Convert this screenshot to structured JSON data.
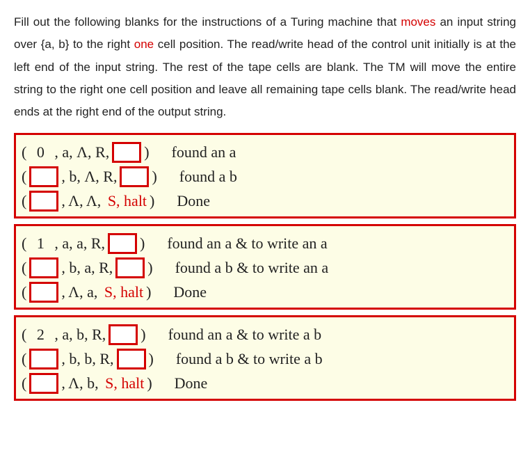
{
  "prompt": {
    "p1a": "Fill out the following blanks for the instructions of a Turing machine that ",
    "p1_moves": "moves",
    "p1b": " an input string over {a, b} to the right ",
    "p1_one": "one",
    "p1c": " cell position. The read/write head of the control unit initially is at the left end of the input string. The rest of the tape cells are blank. The TM will move the entire string to the right one cell position and leave all remaining tape cells blank. The read/write head ends at the right end of the output string."
  },
  "groups": [
    {
      "rows": [
        {
          "state_is_blank": false,
          "state": "0",
          "mid": ", a, Λ, R,",
          "end_blank": true,
          "after_blank": ")",
          "comment": "found an a"
        },
        {
          "state_is_blank": true,
          "state": "",
          "mid": ", b, Λ, R,",
          "end_blank": true,
          "after_blank": ")",
          "comment": "found a b"
        },
        {
          "state_is_blank": true,
          "state": "",
          "mid": ", Λ, Λ, ",
          "halt": "S, halt",
          "after_halt": ")",
          "comment": "Done"
        }
      ]
    },
    {
      "rows": [
        {
          "state_is_blank": false,
          "state": "1",
          "mid": ", a, a, R,",
          "end_blank": true,
          "after_blank": ")",
          "comment": "found an a & to write an a"
        },
        {
          "state_is_blank": true,
          "state": "",
          "mid": ", b, a, R,",
          "end_blank": true,
          "after_blank": ")",
          "comment": "found a b & to write an a"
        },
        {
          "state_is_blank": true,
          "state": "",
          "mid": ", Λ, a, ",
          "halt": "S, halt",
          "after_halt": ")",
          "comment": "Done"
        }
      ]
    },
    {
      "rows": [
        {
          "state_is_blank": false,
          "state": "2",
          "mid": ", a, b, R,",
          "end_blank": true,
          "after_blank": ")",
          "comment": "found an a & to write a b"
        },
        {
          "state_is_blank": true,
          "state": "",
          "mid": ", b, b, R,",
          "end_blank": true,
          "after_blank": ")",
          "comment": "found a b & to write a b"
        },
        {
          "state_is_blank": true,
          "state": "",
          "mid": ", Λ, b, ",
          "halt": "S, halt",
          "after_halt": ")",
          "comment": "Done"
        }
      ]
    }
  ]
}
